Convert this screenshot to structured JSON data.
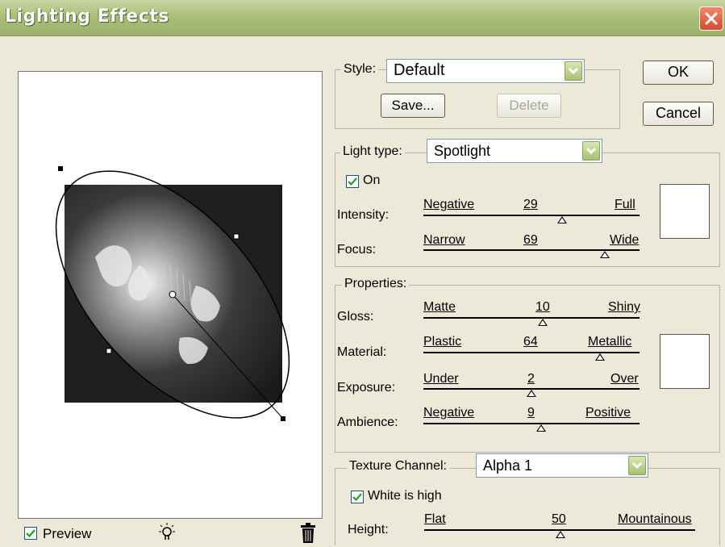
{
  "window": {
    "title": "Lighting Effects"
  },
  "style": {
    "label": "Style:",
    "value": "Default",
    "save_label": "Save...",
    "delete_label": "Delete"
  },
  "buttons": {
    "ok": "OK",
    "cancel": "Cancel"
  },
  "light_type": {
    "label": "Light type:",
    "value": "Spotlight",
    "on_label": "On",
    "on_checked": true
  },
  "intensity": {
    "label": "Intensity:",
    "min_label": "Negative",
    "value": "29",
    "max_label": "Full"
  },
  "focus": {
    "label": "Focus:",
    "min_label": "Narrow",
    "value": "69",
    "max_label": "Wide"
  },
  "properties": {
    "legend": "Properties:",
    "gloss": {
      "label": "Gloss:",
      "min_label": "Matte",
      "value": "10",
      "max_label": "Shiny"
    },
    "material": {
      "label": "Material:",
      "min_label": "Plastic",
      "value": "64",
      "max_label": "Metallic"
    },
    "exposure": {
      "label": "Exposure:",
      "min_label": "Under",
      "value": "2",
      "max_label": "Over"
    },
    "ambience": {
      "label": "Ambience:",
      "min_label": "Negative",
      "value": "9",
      "max_label": "Positive"
    }
  },
  "texture": {
    "label": "Texture Channel:",
    "value": "Alpha 1",
    "white_is_high_label": "White is high",
    "white_is_high_checked": true
  },
  "height": {
    "label": "Height:",
    "min_label": "Flat",
    "value": "50",
    "max_label": "Mountainous"
  },
  "preview": {
    "label": "Preview",
    "checked": true
  },
  "icons": {
    "close": "close-icon",
    "new_light": "light-bulb-icon",
    "delete_light": "trash-icon"
  },
  "colors": {
    "title_bar": "#a9bd78",
    "dialog_bg": "#ece9d8",
    "close_red": "#d74b2b"
  }
}
